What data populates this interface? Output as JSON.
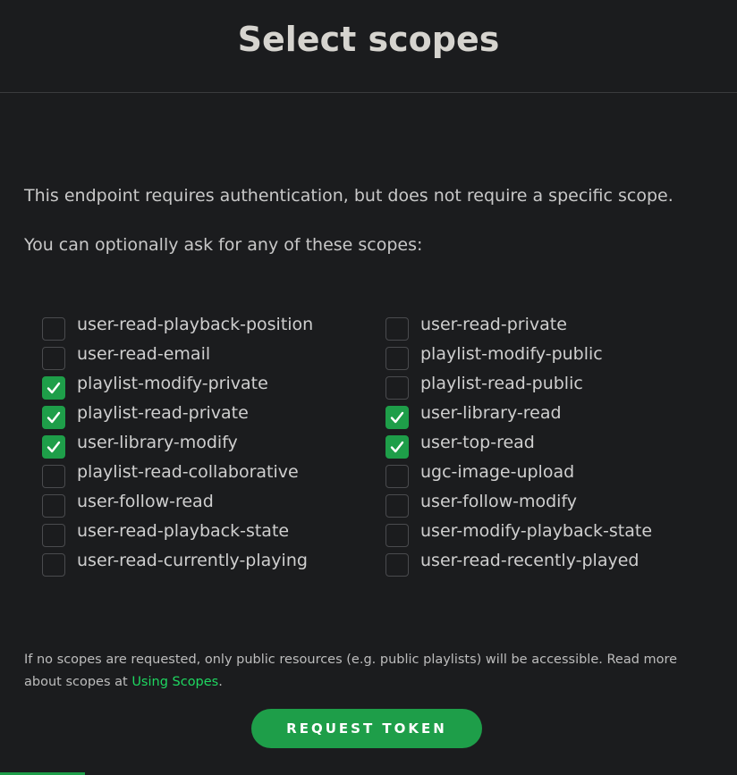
{
  "header": {
    "title": "Select scopes"
  },
  "intro": {
    "line1": "This endpoint requires authentication, but does not require a specific scope.",
    "line2": "You can optionally ask for any of these scopes:"
  },
  "scopes": {
    "left": [
      {
        "label": "user-read-playback-position",
        "checked": false
      },
      {
        "label": "user-read-email",
        "checked": false
      },
      {
        "label": "playlist-modify-private",
        "checked": true
      },
      {
        "label": "playlist-read-private",
        "checked": true
      },
      {
        "label": "user-library-modify",
        "checked": true
      },
      {
        "label": "playlist-read-collaborative",
        "checked": false
      },
      {
        "label": "user-follow-read",
        "checked": false
      },
      {
        "label": "user-read-playback-state",
        "checked": false
      },
      {
        "label": "user-read-currently-playing",
        "checked": false
      }
    ],
    "right": [
      {
        "label": "user-read-private",
        "checked": false
      },
      {
        "label": "playlist-modify-public",
        "checked": false
      },
      {
        "label": "playlist-read-public",
        "checked": false
      },
      {
        "label": "user-library-read",
        "checked": true
      },
      {
        "label": "user-top-read",
        "checked": true
      },
      {
        "label": "ugc-image-upload",
        "checked": false
      },
      {
        "label": "user-follow-modify",
        "checked": false
      },
      {
        "label": "user-modify-playback-state",
        "checked": false
      },
      {
        "label": "user-read-recently-played",
        "checked": false
      }
    ]
  },
  "note": {
    "text_before": "If no scopes are requested, only public resources (e.g. public playlists) will be accessible. Read more about scopes at ",
    "link_text": "Using Scopes",
    "text_after": "."
  },
  "actions": {
    "request_token_label": "REQUEST TOKEN"
  },
  "colors": {
    "accent": "#1e9e49",
    "link": "#1ed760",
    "background": "#1b1c1e"
  },
  "icons": {
    "checkbox_checked": "checkmark-icon"
  }
}
